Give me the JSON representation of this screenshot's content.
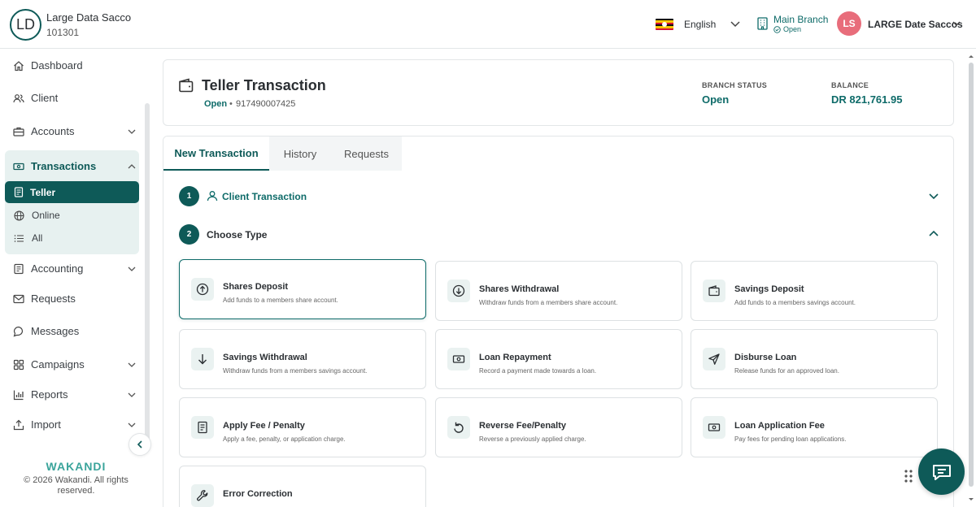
{
  "org": {
    "initials": "LD",
    "name": "Large Data Sacco",
    "code": "101301"
  },
  "topbar": {
    "language": "English",
    "branch_name": "Main Branch",
    "branch_status": "Open",
    "user_initials": "LS",
    "user_name": "LARGE Date Saccos"
  },
  "sidebar": {
    "items": [
      {
        "label": "Dashboard",
        "icon": "home-icon"
      },
      {
        "label": "Client",
        "icon": "users-icon"
      },
      {
        "label": "Accounts",
        "icon": "briefcase-icon"
      },
      {
        "label": "Transactions",
        "icon": "cash-icon"
      },
      {
        "label": "Accounting",
        "icon": "ledger-icon"
      },
      {
        "label": "Requests",
        "icon": "mail-icon"
      },
      {
        "label": "Messages",
        "icon": "chat-icon"
      },
      {
        "label": "Campaigns",
        "icon": "grid-icon"
      },
      {
        "label": "Reports",
        "icon": "bar-chart-icon"
      },
      {
        "label": "Import",
        "icon": "upload-icon"
      }
    ],
    "transactions_sub": [
      {
        "label": "Teller",
        "icon": "receipt-icon"
      },
      {
        "label": "Online",
        "icon": "globe-icon"
      },
      {
        "label": "All",
        "icon": "list-icon"
      }
    ],
    "footer_logo": "WAKANDI",
    "footer_copy": "© 2026 Wakandi. All rights reserved."
  },
  "header": {
    "title": "Teller Transaction",
    "status": "Open",
    "separator": "•",
    "account": "917490007425",
    "branch_status_label": "BRANCH STATUS",
    "branch_status_value": "Open",
    "balance_label": "BALANCE",
    "balance_value": "DR 821,761.95"
  },
  "tabs": [
    "New Transaction",
    "History",
    "Requests"
  ],
  "steps": [
    {
      "number": "1",
      "label": "Client Transaction"
    },
    {
      "number": "2",
      "label": "Choose Type"
    }
  ],
  "types": [
    {
      "title": "Shares Deposit",
      "desc": "Add funds to a members share account.",
      "icon": "arrow-up-circle-icon"
    },
    {
      "title": "Shares Withdrawal",
      "desc": "Withdraw funds from a members share account.",
      "icon": "arrow-down-circle-icon"
    },
    {
      "title": "Savings Deposit",
      "desc": "Add funds to a members savings account.",
      "icon": "wallet-icon"
    },
    {
      "title": "Savings Withdrawal",
      "desc": "Withdraw funds from a members savings account.",
      "icon": "arrow-down-icon"
    },
    {
      "title": "Loan Repayment",
      "desc": "Record a payment made towards a loan.",
      "icon": "cash-icon"
    },
    {
      "title": "Disburse Loan",
      "desc": "Release funds for an approved loan.",
      "icon": "send-icon"
    },
    {
      "title": "Apply Fee / Penalty",
      "desc": "Apply a fee, penalty, or application charge.",
      "icon": "receipt-icon"
    },
    {
      "title": "Reverse Fee/Penalty",
      "desc": "Reverse a previously applied charge.",
      "icon": "undo-icon"
    },
    {
      "title": "Loan Application Fee",
      "desc": "Pay fees for pending loan applications.",
      "icon": "cash-icon"
    },
    {
      "title": "Error Correction",
      "desc": "",
      "icon": "wrench-icon"
    }
  ],
  "colors": {
    "brand": "#0e5a58",
    "brand_light": "#e7f1f0",
    "avatar_user": "#e86d7b"
  }
}
